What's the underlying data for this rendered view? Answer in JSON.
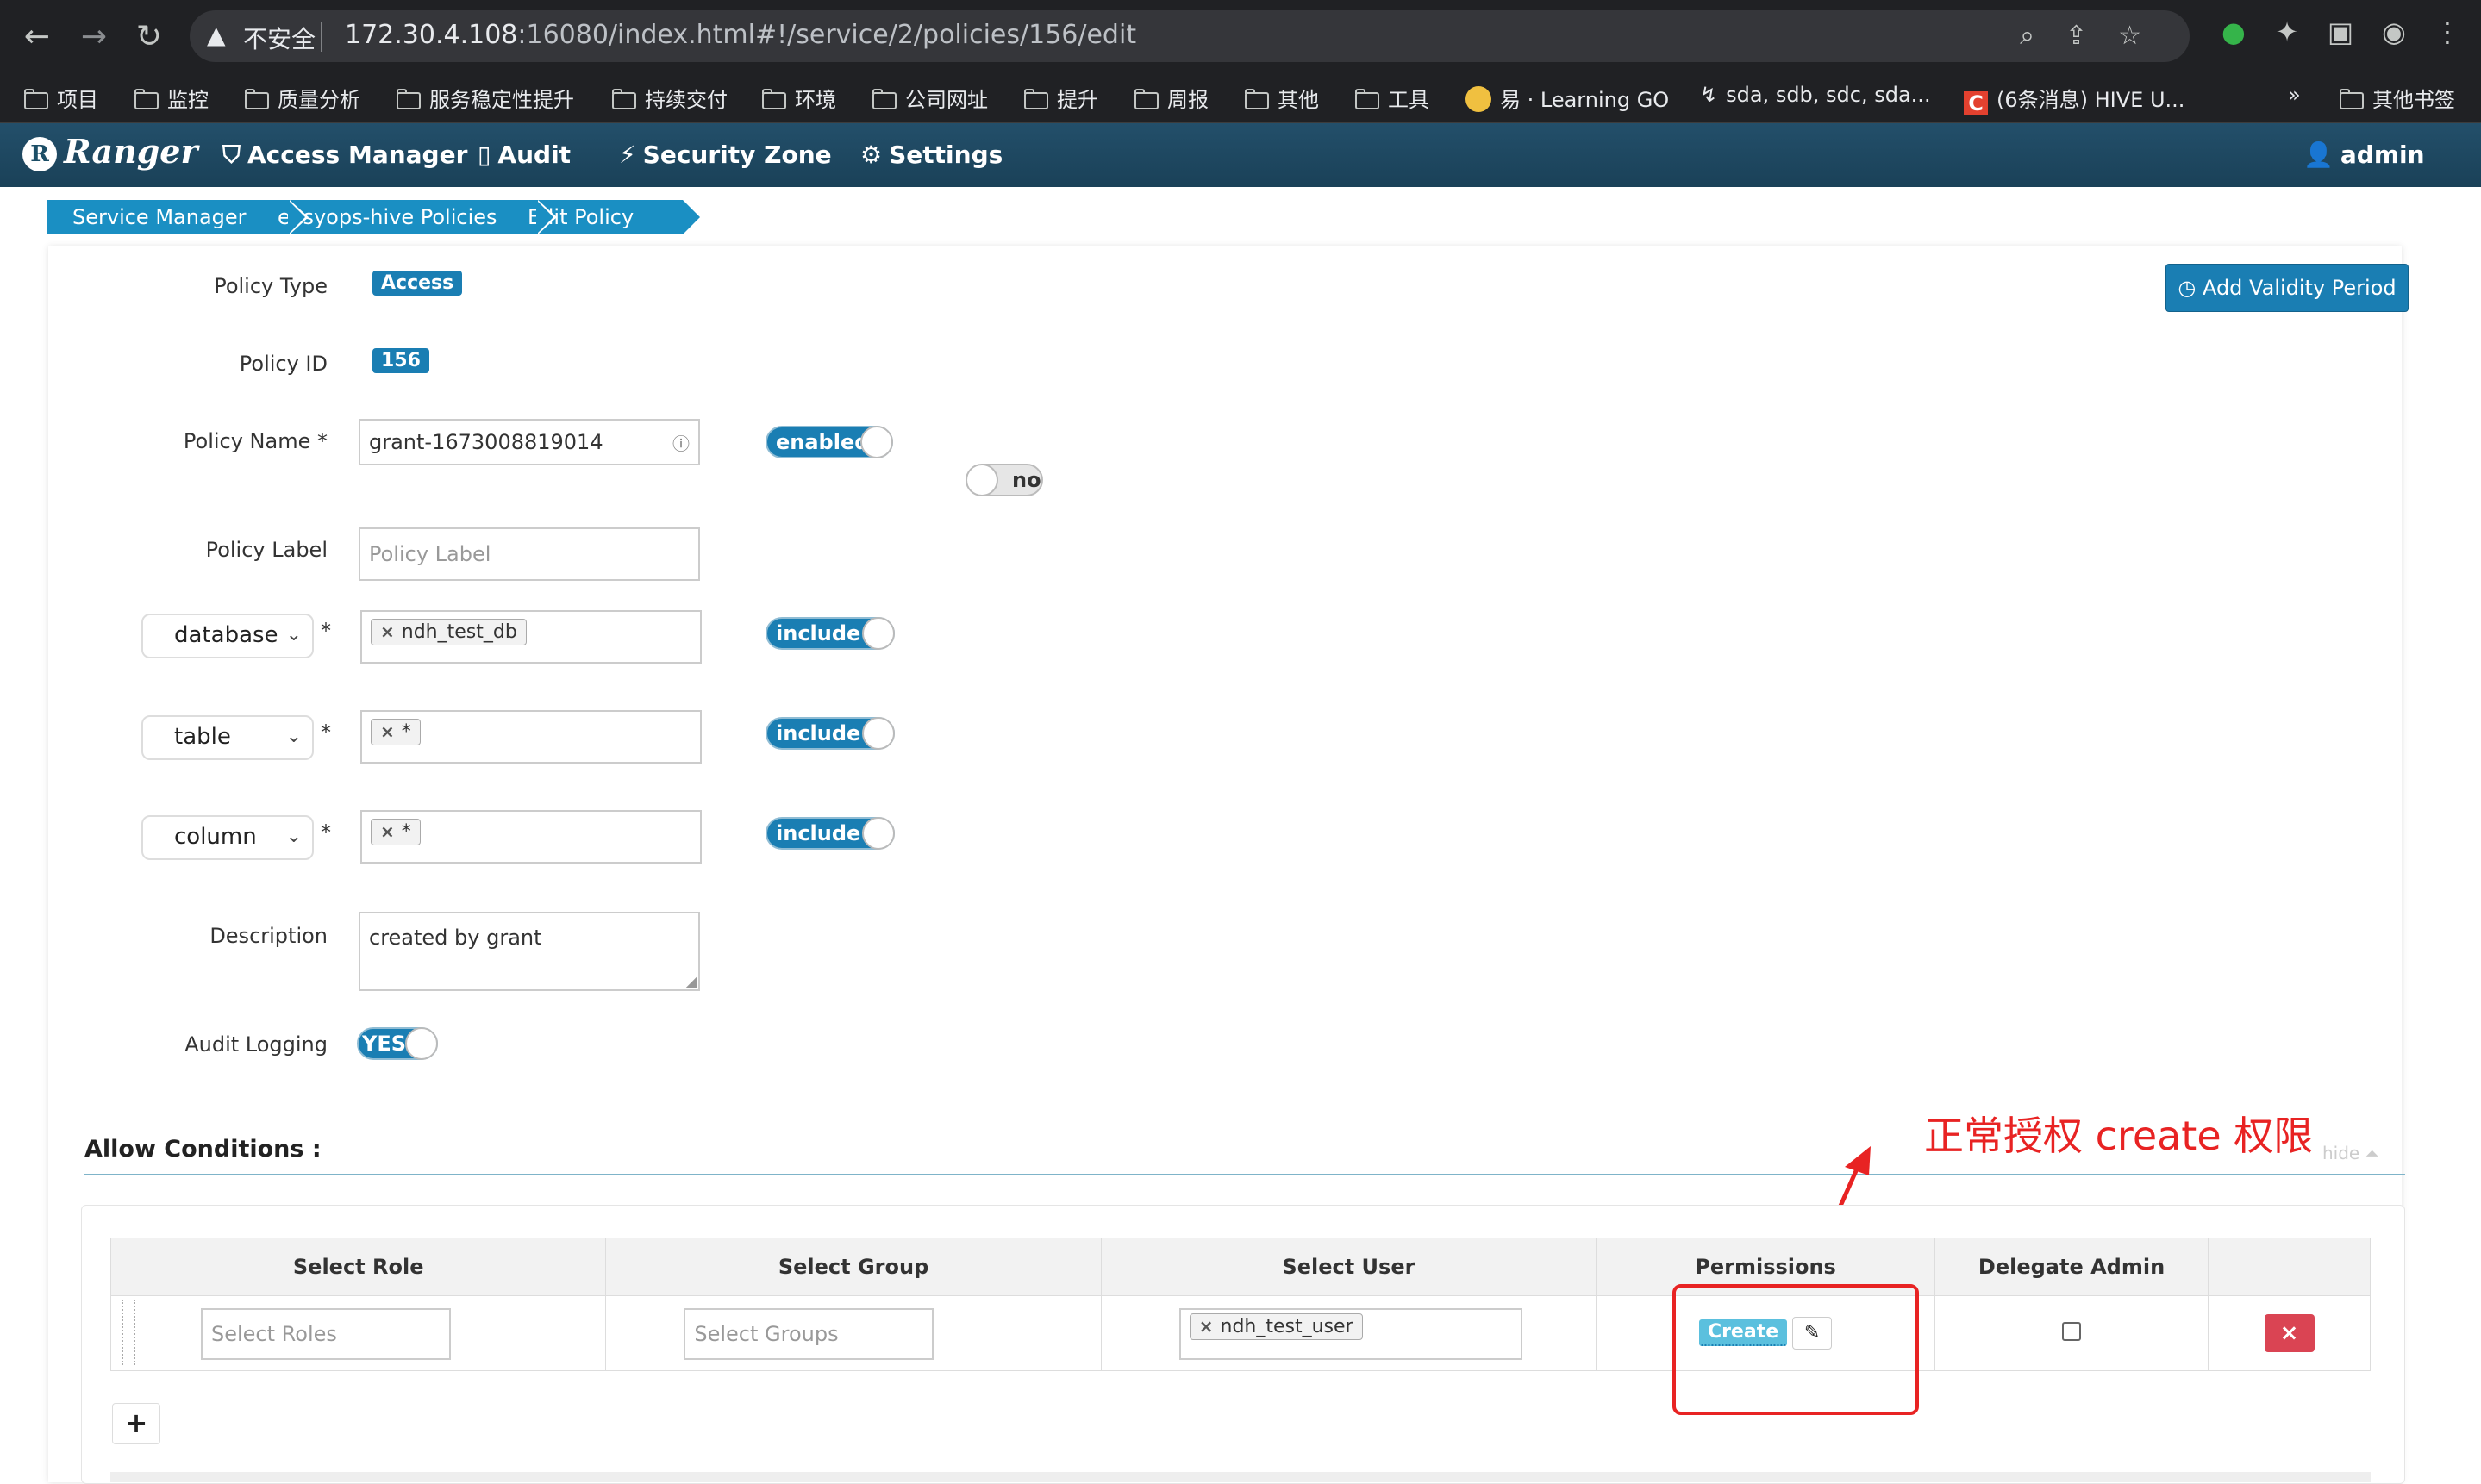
{
  "browser": {
    "insecure_label": "不安全",
    "url_host": "172.30.4.108",
    "url_rest": ":16080/index.html#!/service/2/policies/156/edit",
    "bookmarks": [
      "项目",
      "监控",
      "质量分析",
      "服务稳定性提升",
      "持续交付",
      "环境",
      "公司网址",
      "提升",
      "周报",
      "其他",
      "工具",
      "易 · Learning GO",
      "sda, sdb, sdc, sda...",
      "(6条消息) HIVE U...",
      "»",
      "其他书签"
    ]
  },
  "nav": {
    "brand": "Ranger",
    "items": [
      "Access Manager",
      "Audit",
      "Security Zone",
      "Settings"
    ],
    "user": "admin"
  },
  "breadcrumb": [
    "Service Manager",
    "easyops-hive Policies",
    "Edit Policy"
  ],
  "form": {
    "policy_type_label": "Policy Type",
    "policy_type": "Access",
    "policy_id_label": "Policy ID",
    "policy_id": "156",
    "policy_name_label": "Policy Name",
    "policy_name": "grant-1673008819014",
    "enabled_toggle": "enabled",
    "normal_toggle": "nor",
    "policy_label_label": "Policy Label",
    "policy_label_placeholder": "Policy Label",
    "resources": [
      {
        "type": "database",
        "value": "ndh_test_db",
        "mode": "include"
      },
      {
        "type": "table",
        "value": "*",
        "mode": "include"
      },
      {
        "type": "column",
        "value": "*",
        "mode": "include"
      }
    ],
    "description_label": "Description",
    "description": "created by grant",
    "audit_label": "Audit Logging",
    "audit_value": "YES",
    "add_validity": "Add Validity Period"
  },
  "allow": {
    "title": "Allow Conditions :",
    "hide": "hide",
    "columns": [
      "Select Role",
      "Select Group",
      "Select User",
      "Permissions",
      "Delegate Admin"
    ],
    "row": {
      "role_placeholder": "Select Roles",
      "group_placeholder": "Select Groups",
      "user": "ndh_test_user",
      "permission": "Create",
      "delegate_admin": false
    },
    "add": "+"
  },
  "annotation": "正常授权 create 权限",
  "colors": {
    "accent": "#1a7eb3",
    "annotation": "#e82323",
    "danger": "#da4453"
  }
}
